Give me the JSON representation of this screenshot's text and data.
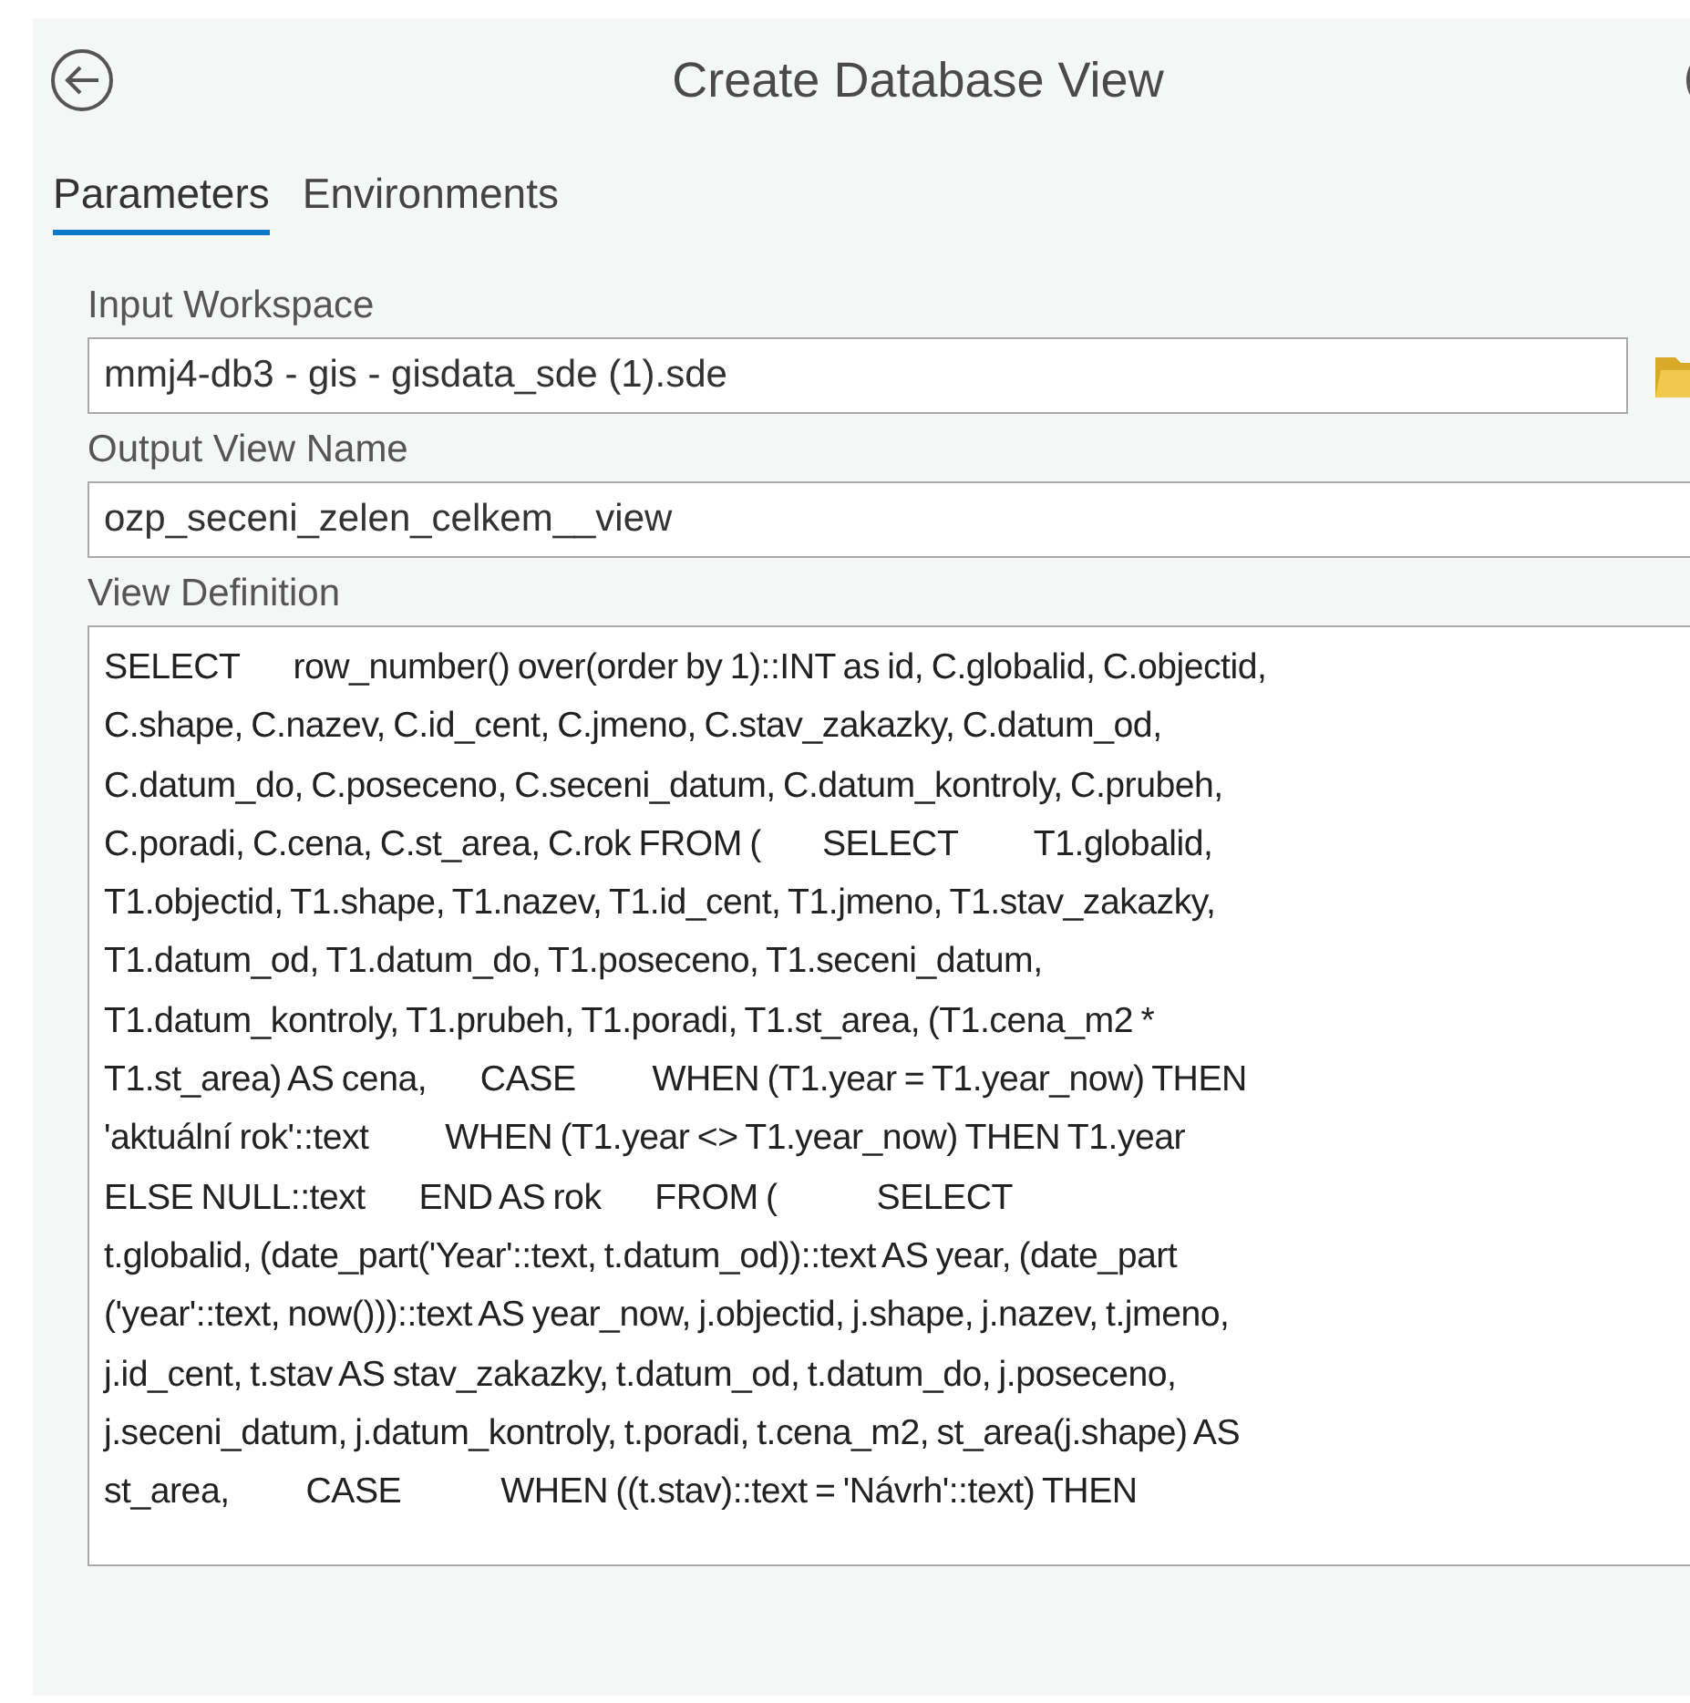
{
  "header": {
    "title": "Create Database View"
  },
  "tabs": [
    {
      "label": "Parameters",
      "selected": true
    },
    {
      "label": "Environments",
      "selected": false
    }
  ],
  "parameters": [
    {
      "kind": "workspace",
      "label": "Input Workspace",
      "value": "mmj4-db3 - gis - gisdata_sde (1).sde"
    },
    {
      "kind": "text",
      "label": "Output View Name",
      "value": "ozp_seceni_zelen_celkem__view"
    },
    {
      "kind": "sql",
      "label": "View Definition",
      "lines": [
        "SELECT       row_number() over(order by 1)::INT as id, C.globalid, C.objectid,",
        "C.shape, C.nazev, C.id_cent, C.jmeno, C.stav_zakazky, C.datum_od,",
        "C.datum_do, C.poseceno, C.seceni_datum, C.datum_kontroly, C.prubeh,",
        "C.poradi, C.cena, C.st_area, C.rok FROM (        SELECT          T1.globalid,",
        "T1.objectid, T1.shape, T1.nazev, T1.id_cent, T1.jmeno, T1.stav_zakazky,",
        "T1.datum_od, T1.datum_do, T1.poseceno, T1.seceni_datum,",
        "T1.datum_kontroly, T1.prubeh, T1.poradi, T1.st_area, (T1.cena_m2 *",
        "T1.st_area) AS cena,       CASE          WHEN (T1.year = T1.year_now) THEN",
        "'aktuální rok'::text          WHEN (T1.year <> T1.year_now) THEN T1.year",
        "ELSE NULL::text       END AS rok       FROM (             SELECT",
        "t.globalid, (date_part('Year'::text, t.datum_od))::text AS year, (date_part",
        "('year'::text, now()))::text AS year_now, j.objectid, j.shape, j.nazev, t.jmeno,",
        "j.id_cent, t.stav AS stav_zakazky, t.datum_od, t.datum_do, j.poseceno,",
        "j.seceni_datum, j.datum_kontroly, t.poradi, t.cena_m2, st_area(j.shape) AS",
        "st_area,          CASE             WHEN ((t.stav)::text = 'Návrh'::text) THEN"
      ]
    }
  ]
}
